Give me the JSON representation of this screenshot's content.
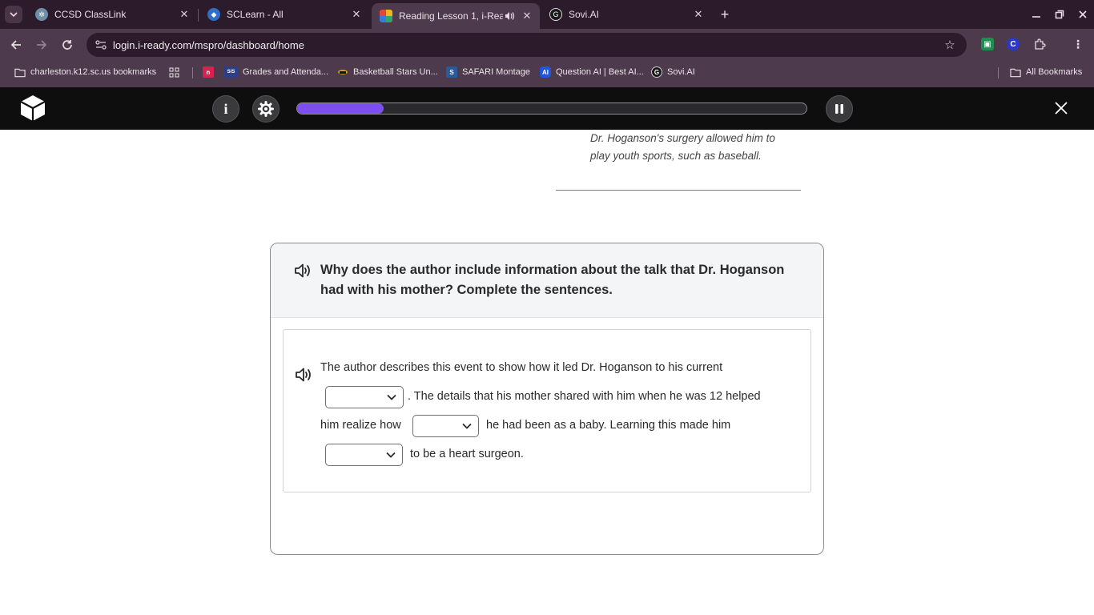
{
  "browser": {
    "tabs": [
      {
        "label": "CCSD ClassLink",
        "active": false
      },
      {
        "label": "SCLearn - All",
        "active": false
      },
      {
        "label": "Reading Lesson 1, i-Ready",
        "active": true
      },
      {
        "label": "Sovi.AI",
        "active": false
      }
    ],
    "url": "login.i-ready.com/mspro/dashboard/home",
    "bookmarks": [
      {
        "label": "charleston.k12.sc.us bookmarks"
      },
      {
        "label": "Grades and Attenda..."
      },
      {
        "label": "Basketball Stars Un..."
      },
      {
        "label": "SAFARI Montage"
      },
      {
        "label": "Question AI | Best AI..."
      },
      {
        "label": "Sovi.AI"
      }
    ],
    "all_bookmarks": "All Bookmarks",
    "sis_badge": "SIS",
    "ai_badge": "AI"
  },
  "lesson": {
    "progress_percent": 17,
    "colors": {
      "progress": "#7d4ff0",
      "header": "#0e0e0f"
    }
  },
  "passage": {
    "closing_text": "Dr. Hoganson's surgery allowed him to play youth sports, such as baseball."
  },
  "question": {
    "prompt": "Why does the author include information about the talk that Dr. Hoganson had with his mother? Complete the sentences.",
    "line1": "The author describes this event to show how it led Dr. Hoganson to his current",
    "line2": ". The details that his mother shared with him when he was 12 helped",
    "line3a": "him realize how",
    "line3b": "he had been as a baby. Learning this made him",
    "line4": "to be a heart surgeon.",
    "dropdowns": [
      {
        "selected": ""
      },
      {
        "selected": ""
      },
      {
        "selected": ""
      }
    ]
  }
}
